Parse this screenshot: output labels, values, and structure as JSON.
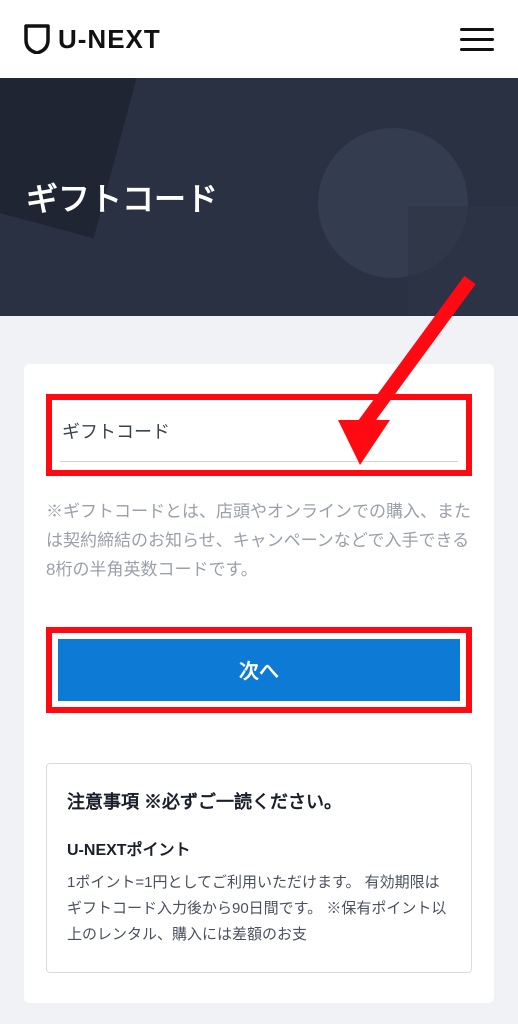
{
  "brand": {
    "name": "U-NEXT"
  },
  "hero": {
    "title": "ギフトコード"
  },
  "form": {
    "placeholder": "ギフトコード",
    "help": "※ギフトコードとは、店頭やオンラインでの購入、または契約締結のお知らせ、キャンペーンなどで入手できる8桁の半角英数コードです。",
    "next_label": "次へ"
  },
  "notes": {
    "title": "注意事項 ※必ずご一読ください。",
    "subtitle": "U-NEXTポイント",
    "body": "1ポイント=1円としてご利用いただけます。\n有効期限はギフトコード入力後から90日間です。\n※保有ポイント以上のレンタル、購入には差額のお支"
  }
}
